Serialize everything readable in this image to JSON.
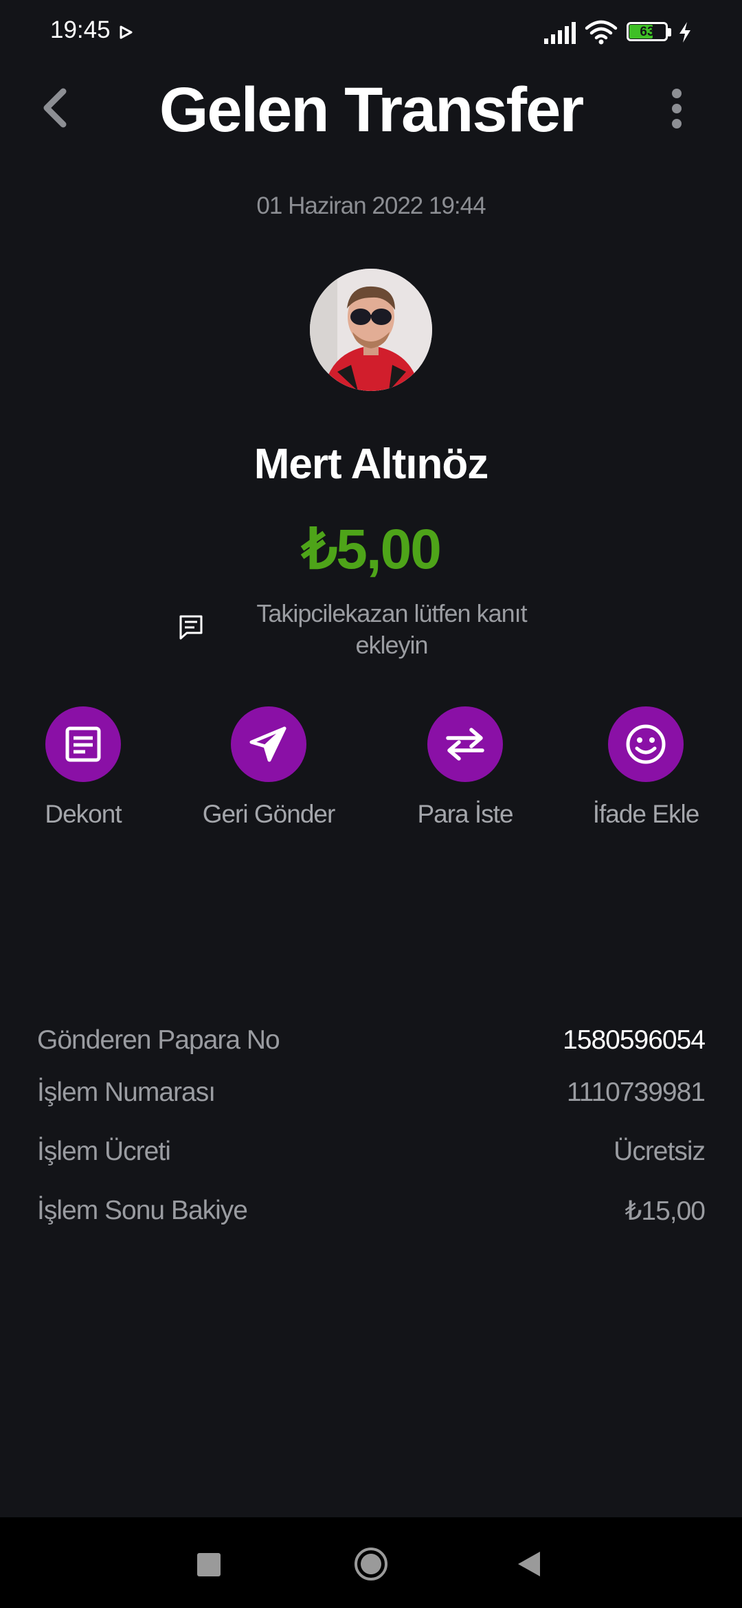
{
  "status_bar": {
    "time": "19:45",
    "battery_level": "63",
    "icons": [
      "play-icon",
      "signal-icon",
      "wifi-icon",
      "battery-icon",
      "charging-icon"
    ]
  },
  "header": {
    "title": "Gelen Transfer",
    "back_icon": "chevron-left-icon",
    "more_icon": "more-vertical-icon"
  },
  "transaction": {
    "date": "01 Haziran 2022 19:44",
    "sender_name": "Mert Altınöz",
    "amount": "₺5,00",
    "amount_color": "#4ea419",
    "note_icon": "message-icon",
    "note": "Takipcilekazan lütfen kanıt ekleyin"
  },
  "actions": [
    {
      "label": "Dekont",
      "icon": "receipt-icon"
    },
    {
      "label": "Geri Gönder",
      "icon": "send-icon"
    },
    {
      "label": "Para İste",
      "icon": "swap-icon"
    },
    {
      "label": "İfade Ekle",
      "icon": "smiley-icon"
    }
  ],
  "action_color": "#8a10a6",
  "details": [
    {
      "label": "Gönderen Papara No",
      "value": "1580596054"
    },
    {
      "label": "İşlem Numarası",
      "value": "1110739981"
    },
    {
      "label": "İşlem Ücreti",
      "value": "Ücretsiz"
    },
    {
      "label": "İşlem Sonu Bakiye",
      "value": "₺15,00"
    }
  ],
  "nav": {
    "icons": [
      "recents-icon",
      "home-icon",
      "back-icon"
    ]
  }
}
